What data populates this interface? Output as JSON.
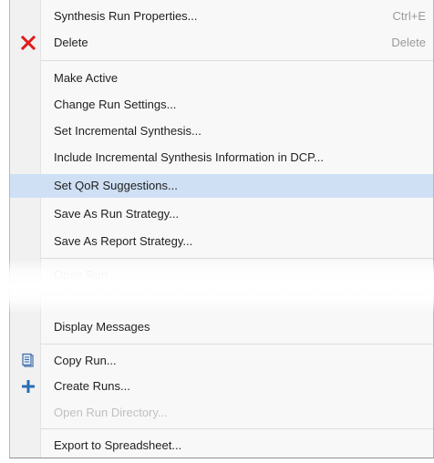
{
  "menu": {
    "items": [
      {
        "label": "Synthesis Run Properties...",
        "shortcut": "Ctrl+E"
      },
      {
        "label": "Delete",
        "shortcut": "Delete",
        "icon": "delete-x-icon"
      },
      {
        "label": "Make Active"
      },
      {
        "label": "Change Run Settings..."
      },
      {
        "label": "Set Incremental Synthesis..."
      },
      {
        "label": "Include Incremental Synthesis Information in DCP..."
      },
      {
        "label": "Set QoR Suggestions...",
        "selected": true
      },
      {
        "label": "Save As Run Strategy..."
      },
      {
        "label": "Save As Report Strategy..."
      },
      {
        "label": "Open Run",
        "disabled": true
      },
      {
        "label": "Display Messages"
      },
      {
        "label": "Copy Run...",
        "icon": "copy-run-icon"
      },
      {
        "label": "Create Runs...",
        "icon": "plus-icon"
      },
      {
        "label": "Open Run Directory...",
        "disabled": true
      },
      {
        "label": "Export to Spreadsheet..."
      }
    ]
  },
  "colors": {
    "delete_icon": "#e01b1b",
    "plus_icon": "#2a6db4",
    "copy_icon": "#3d6aa8",
    "selected_row": "#cfe0f5"
  }
}
